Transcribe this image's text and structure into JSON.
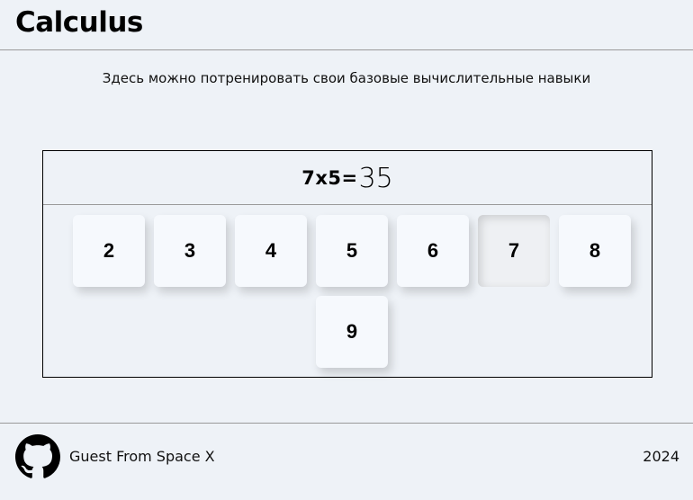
{
  "header": {
    "title": "Calculus"
  },
  "subtitle": "Здесь можно потренировать свои базовые вычислительные навыки",
  "trainer": {
    "equation": "7x5=",
    "answer": "35",
    "keys": [
      {
        "label": "2",
        "pressed": false
      },
      {
        "label": "3",
        "pressed": false
      },
      {
        "label": "4",
        "pressed": false
      },
      {
        "label": "5",
        "pressed": false
      },
      {
        "label": "6",
        "pressed": false
      },
      {
        "label": "7",
        "pressed": true
      },
      {
        "label": "8",
        "pressed": false
      },
      {
        "label": "9",
        "pressed": false
      }
    ]
  },
  "footer": {
    "github_icon": "github-icon",
    "author": "Guest From Space X",
    "year": "2024"
  }
}
